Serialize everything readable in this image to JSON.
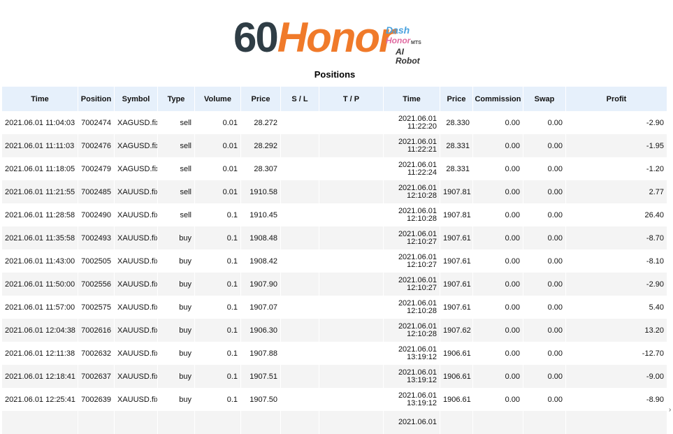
{
  "logo": {
    "num": "60",
    "word": "Honor",
    "dash": "Dash",
    "mini": "Honor",
    "mts": "MTS",
    "ai": "AI Robot"
  },
  "title": "Positions",
  "columns": [
    "Time",
    "Position",
    "Symbol",
    "Type",
    "Volume",
    "Price",
    "S / L",
    "T / P",
    "Time",
    "Price",
    "Commission",
    "Swap",
    "Profit"
  ],
  "rows": [
    [
      "2021.06.01 11:04:03",
      "7002474",
      "XAGUSD.fix",
      "sell",
      "0.01",
      "28.272",
      "",
      "",
      "2021.06.01",
      "11:22:20",
      "28.330",
      "0.00",
      "0.00",
      "-2.90"
    ],
    [
      "2021.06.01 11:11:03",
      "7002476",
      "XAGUSD.fix",
      "sell",
      "0.01",
      "28.292",
      "",
      "",
      "2021.06.01",
      "11:22:21",
      "28.331",
      "0.00",
      "0.00",
      "-1.95"
    ],
    [
      "2021.06.01 11:18:05",
      "7002479",
      "XAGUSD.fix",
      "sell",
      "0.01",
      "28.307",
      "",
      "",
      "2021.06.01",
      "11:22:24",
      "28.331",
      "0.00",
      "0.00",
      "-1.20"
    ],
    [
      "2021.06.01 11:21:55",
      "7002485",
      "XAUUSD.fix",
      "sell",
      "0.01",
      "1910.58",
      "",
      "",
      "2021.06.01",
      "12:10:28",
      "1907.81",
      "0.00",
      "0.00",
      "2.77"
    ],
    [
      "2021.06.01 11:28:58",
      "7002490",
      "XAUUSD.fix",
      "sell",
      "0.1",
      "1910.45",
      "",
      "",
      "2021.06.01",
      "12:10:28",
      "1907.81",
      "0.00",
      "0.00",
      "26.40"
    ],
    [
      "2021.06.01 11:35:58",
      "7002493",
      "XAUUSD.fix",
      "buy",
      "0.1",
      "1908.48",
      "",
      "",
      "2021.06.01",
      "12:10:27",
      "1907.61",
      "0.00",
      "0.00",
      "-8.70"
    ],
    [
      "2021.06.01 11:43:00",
      "7002505",
      "XAUUSD.fix",
      "buy",
      "0.1",
      "1908.42",
      "",
      "",
      "2021.06.01",
      "12:10:27",
      "1907.61",
      "0.00",
      "0.00",
      "-8.10"
    ],
    [
      "2021.06.01 11:50:00",
      "7002556",
      "XAUUSD.fix",
      "buy",
      "0.1",
      "1907.90",
      "",
      "",
      "2021.06.01",
      "12:10:27",
      "1907.61",
      "0.00",
      "0.00",
      "-2.90"
    ],
    [
      "2021.06.01 11:57:00",
      "7002575",
      "XAUUSD.fix",
      "buy",
      "0.1",
      "1907.07",
      "",
      "",
      "2021.06.01",
      "12:10:28",
      "1907.61",
      "0.00",
      "0.00",
      "5.40"
    ],
    [
      "2021.06.01 12:04:38",
      "7002616",
      "XAUUSD.fix",
      "buy",
      "0.1",
      "1906.30",
      "",
      "",
      "2021.06.01",
      "12:10:28",
      "1907.62",
      "0.00",
      "0.00",
      "13.20"
    ],
    [
      "2021.06.01 12:11:38",
      "7002632",
      "XAUUSD.fix",
      "buy",
      "0.1",
      "1907.88",
      "",
      "",
      "2021.06.01",
      "13:19:12",
      "1906.61",
      "0.00",
      "0.00",
      "-12.70"
    ],
    [
      "2021.06.01 12:18:41",
      "7002637",
      "XAUUSD.fix",
      "buy",
      "0.1",
      "1907.51",
      "",
      "",
      "2021.06.01",
      "13:19:12",
      "1906.61",
      "0.00",
      "0.00",
      "-9.00"
    ],
    [
      "2021.06.01 12:25:41",
      "7002639",
      "XAUUSD.fix",
      "buy",
      "0.1",
      "1907.50",
      "",
      "",
      "2021.06.01",
      "13:19:12",
      "1906.61",
      "0.00",
      "0.00",
      "-8.90"
    ],
    [
      "",
      "",
      "",
      "",
      "",
      "",
      "",
      "",
      "2021.06.01",
      "",
      "",
      "",
      "",
      ""
    ]
  ],
  "colors": {
    "header_bg": "#e6f0fb",
    "row_alt_bg": "#f4f4f4",
    "logo_orange": "#f07a2a",
    "logo_dark": "#2f3d45"
  }
}
